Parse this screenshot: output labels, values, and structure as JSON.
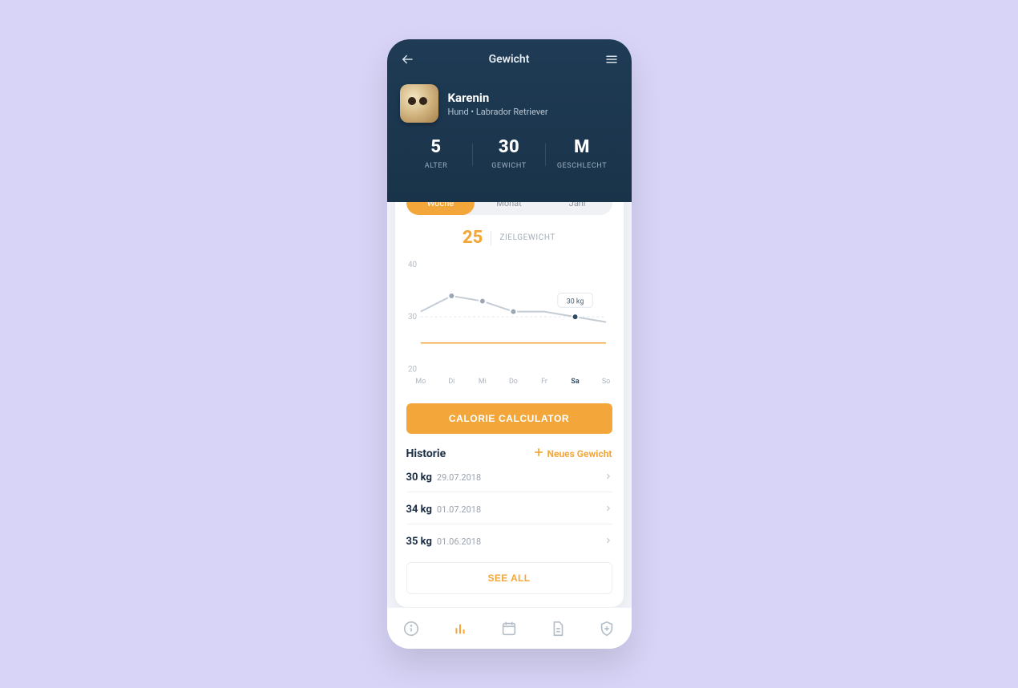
{
  "header": {
    "title": "Gewicht"
  },
  "pet": {
    "name": "Karenin",
    "meta": "Hund • Labrador Retriever"
  },
  "stats": {
    "age": {
      "value": "5",
      "label": "ALTER"
    },
    "weight": {
      "value": "30",
      "label": "GEWICHT"
    },
    "sex": {
      "value": "M",
      "label": "GESCHLECHT"
    }
  },
  "segmented": {
    "week": "Woche",
    "month": "Monat",
    "year": "Jahr"
  },
  "target": {
    "value": "25",
    "label": "ZIELGEWICHT"
  },
  "chart_data": {
    "type": "line",
    "categories": [
      "Mo",
      "Di",
      "Mi",
      "Do",
      "Fr",
      "Sa",
      "So"
    ],
    "values": [
      31,
      34,
      33,
      31,
      31,
      30,
      29
    ],
    "highlight_index": 5,
    "tooltip": "30 kg",
    "target_value": 25,
    "ylim": [
      20,
      40
    ],
    "yticks": [
      20,
      30,
      40
    ],
    "ylabel": "",
    "xlabel": "",
    "title": ""
  },
  "calorie_button": "CALORIE CALCULATOR",
  "history": {
    "title": "Historie",
    "add_label": "Neues Gewicht",
    "items": [
      {
        "weight": "30 kg",
        "date": "29.07.2018"
      },
      {
        "weight": "34 kg",
        "date": "01.07.2018"
      },
      {
        "weight": "35 kg",
        "date": "01.06.2018"
      }
    ],
    "see_all": "SEE ALL"
  },
  "colors": {
    "accent": "#f3a73b",
    "header_bg": "#1f3b55"
  }
}
